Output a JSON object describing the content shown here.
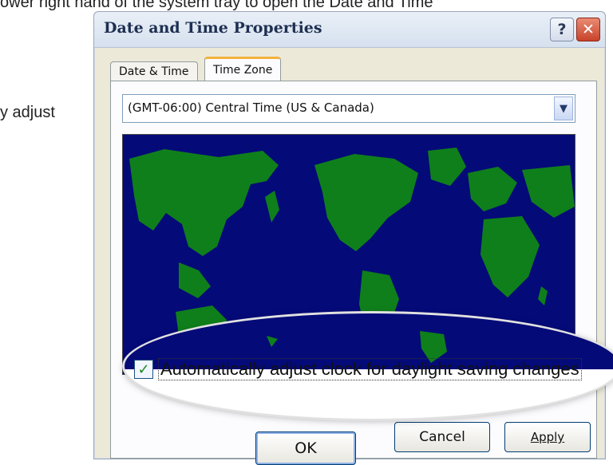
{
  "document": {
    "top_text": "ower right hand of the system tray to open the Date and Time",
    "left_text": "y  adjust"
  },
  "window": {
    "title": "Date and Time Properties",
    "help_label": "?",
    "close_label": "✕"
  },
  "tabs": [
    {
      "label": "Date & Time"
    },
    {
      "label": "Time Zone"
    }
  ],
  "timezone": {
    "selected": "(GMT-06:00) Central Time (US & Canada)"
  },
  "map": {
    "ocean_color": "#040a78",
    "land_color": "#0f7f1b"
  },
  "daylight": {
    "checked": true,
    "label": "Automatically adjust clock for daylight saving changes"
  },
  "buttons": {
    "ok": "OK",
    "cancel": "Cancel",
    "apply": "Apply"
  }
}
